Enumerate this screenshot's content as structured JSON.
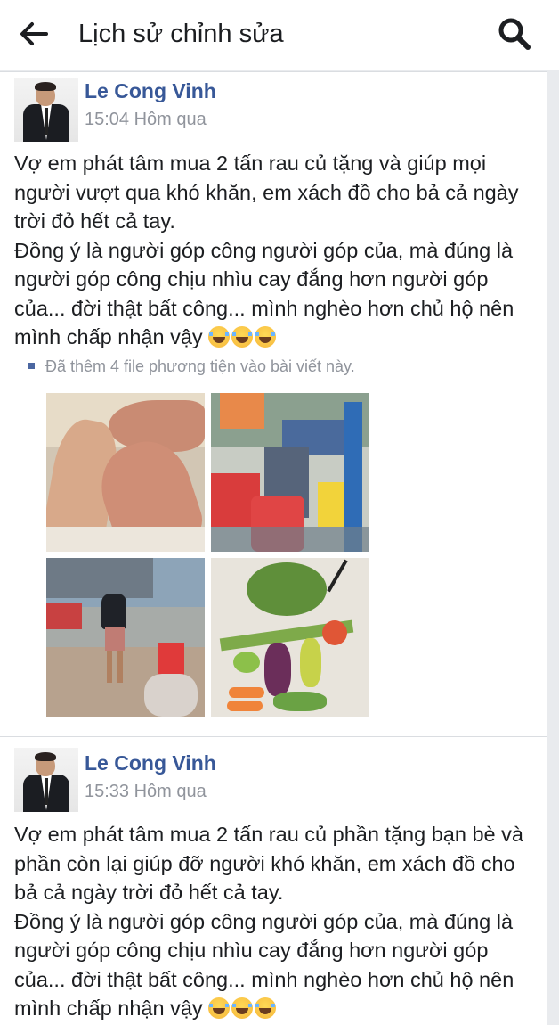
{
  "topbar": {
    "back_icon": "arrow-left-icon",
    "title": "Lịch sử chỉnh sửa",
    "search_icon": "search-icon"
  },
  "posts": [
    {
      "author": "Le Cong Vinh",
      "time": "15:04 Hôm qua",
      "text": "Vợ em phát tâm mua 2 tấn rau củ tặng và giúp mọi người vượt qua khó khăn, em xách đồ cho bả cả ngày trời đỏ hết cả tay.\nĐồng ý là người góp công người góp của, mà đúng là người góp công chịu nhìu cay đắng hơn người góp của... đời thật bất công... mình nghèo hơn chủ hộ nên mình chấp nhận vậy",
      "emojis": [
        "laughing-tears-emoji",
        "laughing-tears-emoji",
        "laughing-tears-emoji"
      ],
      "media_note": "Đã thêm 4 file phương tiện vào bài viết này.",
      "photos": [
        "hands-photo",
        "vegetable-bags-photo",
        "street-vendor-photo",
        "vegetables-on-floor-photo"
      ]
    },
    {
      "author": "Le Cong Vinh",
      "time": "15:33 Hôm qua",
      "text": "Vợ em phát tâm mua 2 tấn rau củ phần tặng bạn bè và phần còn lại giúp đỡ người khó khăn, em xách đồ cho bả cả ngày trời đỏ hết cả tay.\nĐồng ý là người góp công người góp của, mà đúng là người góp công chịu nhìu cay đắng hơn người góp của... đời thật bất công... mình nghèo hơn chủ hộ nên mình chấp nhận vậy",
      "emojis": [
        "laughing-tears-emoji",
        "laughing-tears-emoji",
        "laughing-tears-emoji"
      ]
    }
  ]
}
